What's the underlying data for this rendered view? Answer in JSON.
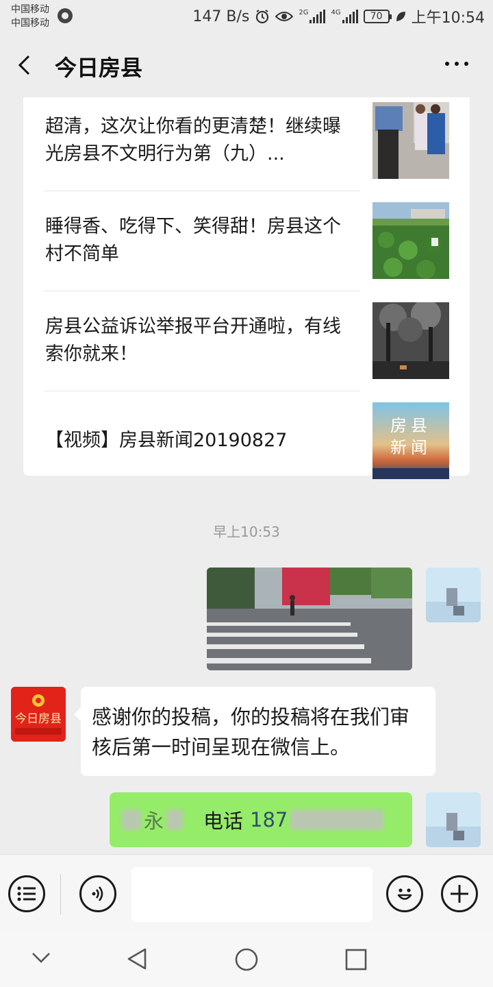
{
  "status_bar": {
    "carrier_1": "中国移动",
    "carrier_2": "中国移动",
    "net_speed": "147 B/s",
    "net_badge_1": "2G",
    "net_badge_2": "4G",
    "battery": "70",
    "time": "上午10:54"
  },
  "header": {
    "title": "今日房县"
  },
  "articles": [
    {
      "title": "超清，这次让你看的更清楚！继续曝光房县不文明行为第（九）..."
    },
    {
      "title": "睡得香、吃得下、笑得甜！房县这个村不简单"
    },
    {
      "title": "房县公益诉讼举报平台开通啦，有线索你就来！"
    },
    {
      "title": "【视频】房县新闻20190827",
      "thumb_text_1": "房县",
      "thumb_text_2": "新闻"
    }
  ],
  "chat": {
    "timestamp": "早上10:53",
    "bot_avatar_text": "今日房县",
    "bot_reply": "感谢你的投稿，你的投稿将在我们审核后第一时间呈现在微信上。",
    "user_message": {
      "name_visible": "永",
      "phone_label": "电话",
      "phone_visible": "187"
    }
  },
  "colors": {
    "background": "#ededed",
    "bubble_green": "#95ec69",
    "bot_avatar": "#e2231a"
  }
}
